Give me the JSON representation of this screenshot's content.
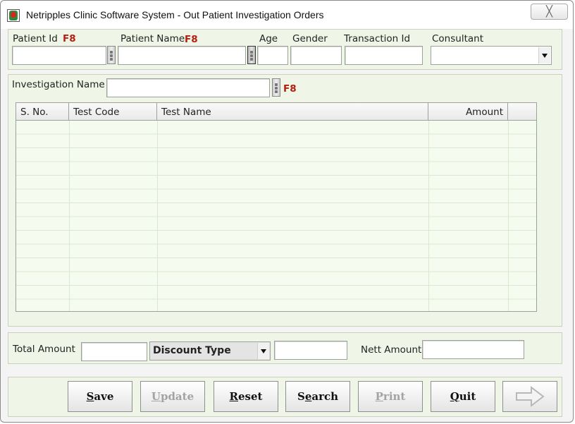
{
  "window": {
    "title": "Netripples Clinic Software System - Out Patient Investigation Orders",
    "close_glyph": "╳"
  },
  "patient": {
    "patient_id_label": "Patient Id",
    "patient_name_label": "Patient Name",
    "age_label": "Age",
    "gender_label": "Gender",
    "transaction_id_label": "Transaction Id",
    "consultant_label": "Consultant",
    "hotkey": "F8",
    "patient_id_value": "",
    "patient_name_value": "",
    "age_value": "",
    "gender_value": "",
    "transaction_id_value": "",
    "consultant_value": ""
  },
  "investigation": {
    "label": "Investigation Name",
    "hotkey": "F8",
    "value": ""
  },
  "grid": {
    "columns": [
      "S. No.",
      "Test Code",
      "Test Name",
      "Amount"
    ],
    "rows": []
  },
  "totals": {
    "total_amount_label": "Total Amount",
    "total_amount_value": "",
    "discount_type_label": "Discount Type",
    "discount_value": "",
    "nett_amount_label": "Nett Amount",
    "nett_amount_value": ""
  },
  "buttons": {
    "save": {
      "mnemonic": "S",
      "rest": "ave"
    },
    "update": {
      "mnemonic": "U",
      "rest": "pdate"
    },
    "reset": {
      "mnemonic": "R",
      "rest": "eset"
    },
    "search": {
      "pre": "S",
      "mnemonic": "e",
      "rest": "arch"
    },
    "print": {
      "mnemonic": "P",
      "rest": "rint"
    },
    "quit": {
      "mnemonic": "Q",
      "rest": "uit"
    },
    "next_icon": "arrow-right-icon"
  }
}
